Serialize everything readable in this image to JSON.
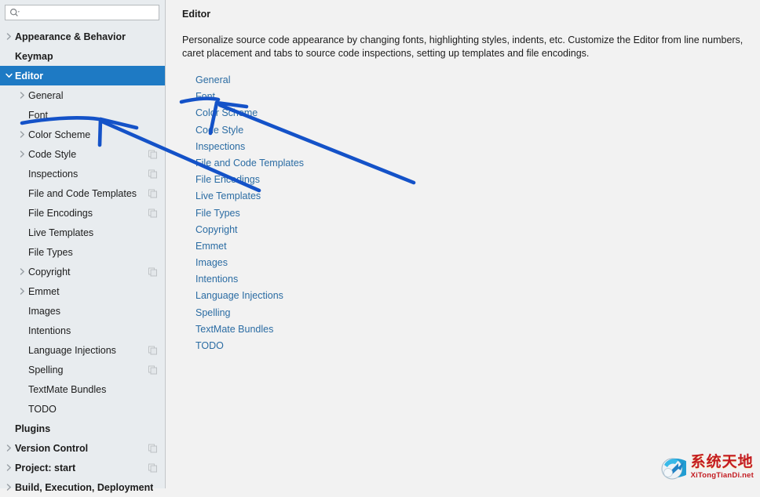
{
  "search": {
    "placeholder": "",
    "value": "",
    "icon": "search-icon"
  },
  "sidebar": {
    "items": [
      {
        "label": "Appearance & Behavior",
        "level": 0,
        "bold": true,
        "twisty": "collapsed",
        "badge": false,
        "selected": false
      },
      {
        "label": "Keymap",
        "level": 0,
        "bold": true,
        "twisty": "none",
        "badge": false,
        "selected": false
      },
      {
        "label": "Editor",
        "level": 0,
        "bold": true,
        "twisty": "expanded",
        "badge": false,
        "selected": true
      },
      {
        "label": "General",
        "level": 1,
        "bold": false,
        "twisty": "collapsed",
        "badge": false,
        "selected": false
      },
      {
        "label": "Font",
        "level": 1,
        "bold": false,
        "twisty": "none",
        "badge": false,
        "selected": false
      },
      {
        "label": "Color Scheme",
        "level": 1,
        "bold": false,
        "twisty": "collapsed",
        "badge": false,
        "selected": false
      },
      {
        "label": "Code Style",
        "level": 1,
        "bold": false,
        "twisty": "collapsed",
        "badge": true,
        "selected": false
      },
      {
        "label": "Inspections",
        "level": 1,
        "bold": false,
        "twisty": "none",
        "badge": true,
        "selected": false
      },
      {
        "label": "File and Code Templates",
        "level": 1,
        "bold": false,
        "twisty": "none",
        "badge": true,
        "selected": false
      },
      {
        "label": "File Encodings",
        "level": 1,
        "bold": false,
        "twisty": "none",
        "badge": true,
        "selected": false
      },
      {
        "label": "Live Templates",
        "level": 1,
        "bold": false,
        "twisty": "none",
        "badge": false,
        "selected": false
      },
      {
        "label": "File Types",
        "level": 1,
        "bold": false,
        "twisty": "none",
        "badge": false,
        "selected": false
      },
      {
        "label": "Copyright",
        "level": 1,
        "bold": false,
        "twisty": "collapsed",
        "badge": true,
        "selected": false
      },
      {
        "label": "Emmet",
        "level": 1,
        "bold": false,
        "twisty": "collapsed",
        "badge": false,
        "selected": false
      },
      {
        "label": "Images",
        "level": 1,
        "bold": false,
        "twisty": "none",
        "badge": false,
        "selected": false
      },
      {
        "label": "Intentions",
        "level": 1,
        "bold": false,
        "twisty": "none",
        "badge": false,
        "selected": false
      },
      {
        "label": "Language Injections",
        "level": 1,
        "bold": false,
        "twisty": "none",
        "badge": true,
        "selected": false
      },
      {
        "label": "Spelling",
        "level": 1,
        "bold": false,
        "twisty": "none",
        "badge": true,
        "selected": false
      },
      {
        "label": "TextMate Bundles",
        "level": 1,
        "bold": false,
        "twisty": "none",
        "badge": false,
        "selected": false
      },
      {
        "label": "TODO",
        "level": 1,
        "bold": false,
        "twisty": "none",
        "badge": false,
        "selected": false
      },
      {
        "label": "Plugins",
        "level": 0,
        "bold": true,
        "twisty": "none",
        "badge": false,
        "selected": false
      },
      {
        "label": "Version Control",
        "level": 0,
        "bold": true,
        "twisty": "collapsed",
        "badge": true,
        "selected": false
      },
      {
        "label": "Project: start",
        "level": 0,
        "bold": true,
        "twisty": "collapsed",
        "badge": true,
        "selected": false
      },
      {
        "label": "Build, Execution, Deployment",
        "level": 0,
        "bold": true,
        "twisty": "collapsed",
        "badge": false,
        "selected": false
      }
    ]
  },
  "main": {
    "title": "Editor",
    "description": "Personalize source code appearance by changing fonts, highlighting styles, indents, etc. Customize the Editor from line numbers, caret placement and tabs to source code inspections, setting up templates and file encodings.",
    "links": [
      "General",
      "Font",
      "Color Scheme",
      "Code Style",
      "Inspections",
      "File and Code Templates",
      "File Encodings",
      "Live Templates",
      "File Types",
      "Copyright",
      "Emmet",
      "Images",
      "Intentions",
      "Language Injections",
      "Spelling",
      "TextMate Bundles",
      "TODO"
    ]
  },
  "annotations": {
    "color": "#1452c8",
    "shapes": [
      "underline-under-sidebar-font",
      "arrow-pointing-to-sidebar-font",
      "underline-under-panel-font-link",
      "arrow-pointing-to-panel-font-link",
      "long-diagonal-connector"
    ]
  },
  "watermark": {
    "chinese": "系统天地",
    "latin": "XiTongTianDi.net",
    "color": "#c2151b"
  },
  "colors": {
    "selection": "#1e7ac4",
    "link": "#2b6ca3",
    "sidebar_bg": "#e8ecef",
    "main_bg": "#f2f2f2",
    "annotation": "#1452c8"
  }
}
